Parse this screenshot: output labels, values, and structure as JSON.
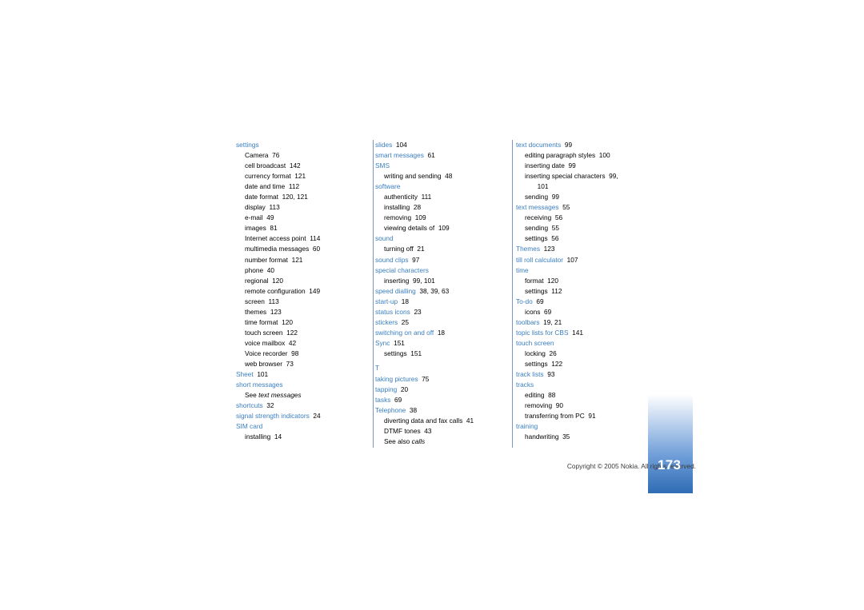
{
  "document": {
    "footer_text": "Copyright © 2005 Nokia. All rights reserved.",
    "page_number": "173"
  },
  "columns": [
    {
      "id": "column-1",
      "entries": [
        {
          "type": "head",
          "label": "settings",
          "page": ""
        },
        {
          "type": "sub",
          "label": "Camera",
          "page": "76"
        },
        {
          "type": "sub",
          "label": "cell broadcast",
          "page": "142"
        },
        {
          "type": "sub",
          "label": "currency format",
          "page": "121"
        },
        {
          "type": "sub",
          "label": "date and time",
          "page": "112"
        },
        {
          "type": "sub",
          "label": "date format",
          "page": "120, 121"
        },
        {
          "type": "sub",
          "label": "display",
          "page": "113"
        },
        {
          "type": "sub",
          "label": "e-mail",
          "page": "49"
        },
        {
          "type": "sub",
          "label": "images",
          "page": "81"
        },
        {
          "type": "sub",
          "label": "Internet access point",
          "page": "114"
        },
        {
          "type": "sub",
          "label": "multimedia messages",
          "page": "60"
        },
        {
          "type": "sub",
          "label": "number format",
          "page": "121"
        },
        {
          "type": "sub",
          "label": "phone",
          "page": "40"
        },
        {
          "type": "sub",
          "label": "regional",
          "page": "120"
        },
        {
          "type": "sub",
          "label": "remote configuration",
          "page": "149"
        },
        {
          "type": "sub",
          "label": "screen",
          "page": "113"
        },
        {
          "type": "sub",
          "label": "themes",
          "page": "123"
        },
        {
          "type": "sub",
          "label": "time format",
          "page": "120"
        },
        {
          "type": "sub",
          "label": "touch screen",
          "page": "122"
        },
        {
          "type": "sub",
          "label": "voice mailbox",
          "page": "42"
        },
        {
          "type": "sub",
          "label": "Voice recorder",
          "page": "98"
        },
        {
          "type": "sub",
          "label": "web browser",
          "page": "73"
        },
        {
          "type": "head",
          "label": "Sheet",
          "page": "101"
        },
        {
          "type": "head",
          "label": "short messages",
          "page": ""
        },
        {
          "type": "sub-italic",
          "label": "See",
          "italic": "text messages",
          "page": ""
        },
        {
          "type": "head",
          "label": "shortcuts",
          "page": "32"
        },
        {
          "type": "head",
          "label": "signal strength indicators",
          "page": "24"
        },
        {
          "type": "head",
          "label": "SIM card",
          "page": ""
        },
        {
          "type": "sub",
          "label": "installing",
          "page": "14"
        }
      ]
    },
    {
      "id": "column-2",
      "entries": [
        {
          "type": "head",
          "label": "slides",
          "page": "104"
        },
        {
          "type": "head",
          "label": "smart messages",
          "page": "61"
        },
        {
          "type": "head",
          "label": "SMS",
          "page": ""
        },
        {
          "type": "sub",
          "label": "writing and sending",
          "page": "48"
        },
        {
          "type": "head",
          "label": "software",
          "page": ""
        },
        {
          "type": "sub",
          "label": "authenticity",
          "page": "111"
        },
        {
          "type": "sub",
          "label": "installing",
          "page": "28"
        },
        {
          "type": "sub",
          "label": "removing",
          "page": "109"
        },
        {
          "type": "sub",
          "label": "viewing details of",
          "page": "109"
        },
        {
          "type": "head",
          "label": "sound",
          "page": ""
        },
        {
          "type": "sub",
          "label": "turning off",
          "page": "21"
        },
        {
          "type": "head",
          "label": "sound clips",
          "page": "97"
        },
        {
          "type": "head",
          "label": "special characters",
          "page": ""
        },
        {
          "type": "sub",
          "label": "inserting",
          "page": "99, 101"
        },
        {
          "type": "head",
          "label": "speed dialling",
          "page": "38, 39, 63"
        },
        {
          "type": "head",
          "label": "start-up",
          "page": "18"
        },
        {
          "type": "head",
          "label": "status icons",
          "page": "23"
        },
        {
          "type": "head",
          "label": "stickers",
          "page": "25"
        },
        {
          "type": "head",
          "label": "switching on and off",
          "page": "18"
        },
        {
          "type": "head",
          "label": "Sync",
          "page": "151"
        },
        {
          "type": "sub",
          "label": "settings",
          "page": "151"
        },
        {
          "type": "letter",
          "label": "T",
          "page": ""
        },
        {
          "type": "head",
          "label": "taking pictures",
          "page": "75"
        },
        {
          "type": "head",
          "label": "tapping",
          "page": "20"
        },
        {
          "type": "head",
          "label": "tasks",
          "page": "69"
        },
        {
          "type": "head",
          "label": "Telephone",
          "page": "38"
        },
        {
          "type": "sub",
          "label": "diverting data and fax calls",
          "page": "41"
        },
        {
          "type": "sub",
          "label": "DTMF tones",
          "page": "43"
        },
        {
          "type": "sub-italic",
          "label": "See also",
          "italic": "calls",
          "page": ""
        }
      ]
    },
    {
      "id": "column-3",
      "entries": [
        {
          "type": "head",
          "label": "text documents",
          "page": "99"
        },
        {
          "type": "sub",
          "label": "editing paragraph styles",
          "page": "100"
        },
        {
          "type": "sub",
          "label": "inserting date",
          "page": "99"
        },
        {
          "type": "sub",
          "label": "inserting special characters",
          "page": "99,"
        },
        {
          "type": "sub2",
          "label": "",
          "page": "101"
        },
        {
          "type": "sub",
          "label": "sending",
          "page": "99"
        },
        {
          "type": "head",
          "label": "text messages",
          "page": "55"
        },
        {
          "type": "sub",
          "label": "receiving",
          "page": "56"
        },
        {
          "type": "sub",
          "label": "sending",
          "page": "55"
        },
        {
          "type": "sub",
          "label": "settings",
          "page": "56"
        },
        {
          "type": "head",
          "label": "Themes",
          "page": "123"
        },
        {
          "type": "head",
          "label": "till roll calculator",
          "page": "107"
        },
        {
          "type": "head",
          "label": "time",
          "page": ""
        },
        {
          "type": "sub",
          "label": "format",
          "page": "120"
        },
        {
          "type": "sub",
          "label": "settings",
          "page": "112"
        },
        {
          "type": "head",
          "label": "To-do",
          "page": "69"
        },
        {
          "type": "sub",
          "label": "icons",
          "page": "69"
        },
        {
          "type": "head",
          "label": "toolbars",
          "page": "19, 21"
        },
        {
          "type": "head",
          "label": "topic lists for CBS",
          "page": "141"
        },
        {
          "type": "head",
          "label": "touch screen",
          "page": ""
        },
        {
          "type": "sub",
          "label": "locking",
          "page": "26"
        },
        {
          "type": "sub",
          "label": "settings",
          "page": "122"
        },
        {
          "type": "head",
          "label": "track lists",
          "page": "93"
        },
        {
          "type": "head",
          "label": "tracks",
          "page": ""
        },
        {
          "type": "sub",
          "label": "editing",
          "page": "88"
        },
        {
          "type": "sub",
          "label": "removing",
          "page": "90"
        },
        {
          "type": "sub",
          "label": "transferring from PC",
          "page": "91"
        },
        {
          "type": "head",
          "label": "training",
          "page": ""
        },
        {
          "type": "sub",
          "label": "handwriting",
          "page": "35"
        }
      ]
    }
  ]
}
